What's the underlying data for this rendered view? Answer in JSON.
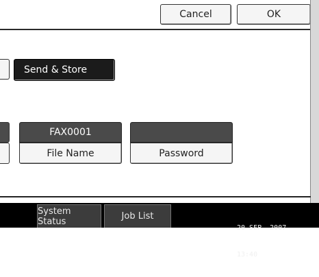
{
  "toolbar": {
    "cancel_label": "Cancel",
    "ok_label": "OK"
  },
  "mode": {
    "send_store_label": "Send & Store"
  },
  "fields": {
    "file_name_value": "FAX0001",
    "file_name_label": "File Name",
    "password_value": "",
    "password_label": "Password"
  },
  "status_bar": {
    "system_status_label": "System Status",
    "job_list_label": "Job List",
    "date": "20 SEP  2007",
    "time": "13:40"
  }
}
